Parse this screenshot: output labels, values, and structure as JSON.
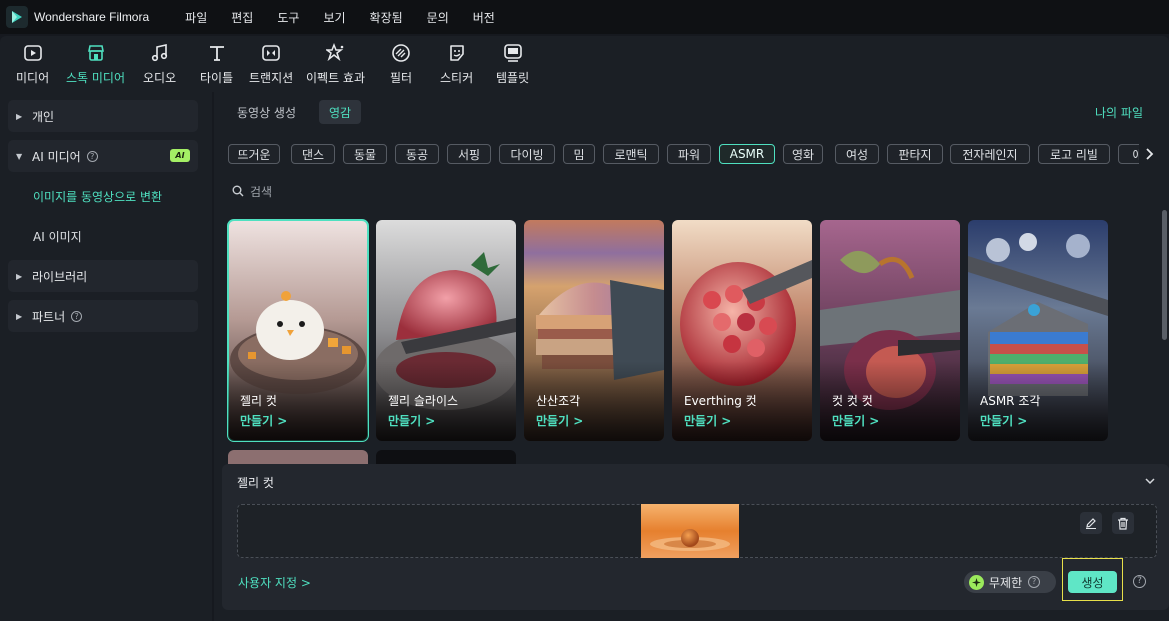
{
  "app": {
    "title": "Wondershare Filmora"
  },
  "menu": [
    "파일",
    "편집",
    "도구",
    "보기",
    "확장됨",
    "문의",
    "버전"
  ],
  "toolbar": [
    {
      "label": "미디어",
      "icon": "media-icon"
    },
    {
      "label": "스톡 미디어",
      "icon": "stock-media-icon",
      "active": true
    },
    {
      "label": "오디오",
      "icon": "audio-icon"
    },
    {
      "label": "타이틀",
      "icon": "title-icon"
    },
    {
      "label": "트랜지션",
      "icon": "transition-icon"
    },
    {
      "label": "이펙트 효과",
      "icon": "effects-icon"
    },
    {
      "label": "필터",
      "icon": "filter-icon"
    },
    {
      "label": "스티커",
      "icon": "sticker-icon"
    },
    {
      "label": "템플릿",
      "icon": "template-icon"
    }
  ],
  "sidebar": {
    "personal": "개인",
    "ai_media": "AI 미디어",
    "ai_badge": "AI",
    "image_to_video": "이미지를 동영상으로 변환",
    "ai_image": "AI 이미지",
    "library": "라이브러리",
    "partner": "파트너"
  },
  "tabs": {
    "generate": "동영상 생성",
    "inspiration": "영감",
    "my_files": "나의 파일"
  },
  "chips": [
    "뜨거운",
    "댄스",
    "동물",
    "동공",
    "서핑",
    "다이빙",
    "밈",
    "로맨틱",
    "파워",
    "ASMR",
    "영화",
    "여성",
    "판타지",
    "전자레인지",
    "로고 리빌",
    "애"
  ],
  "active_chip": "ASMR",
  "search": {
    "placeholder": "검색"
  },
  "cards": [
    {
      "name": "젤리 컷",
      "action": "만들기 >"
    },
    {
      "name": "젤리 슬라이스",
      "action": "만들기 >"
    },
    {
      "name": "산산조각",
      "action": "만들기 >"
    },
    {
      "name": "Everthing 컷",
      "action": "만들기 >"
    },
    {
      "name": "컷 컷 컷",
      "action": "만들기 >"
    },
    {
      "name": "ASMR 조각",
      "action": "만들기 >"
    }
  ],
  "gen_panel": {
    "title": "젤리 컷",
    "custom_link": "사용자 지정 >",
    "unlimited": "무제한",
    "generate": "생성"
  },
  "colors": {
    "accent": "#4fe0c0",
    "ai_badge": "#a4f065",
    "highlight_frame": "#e8e04a"
  }
}
